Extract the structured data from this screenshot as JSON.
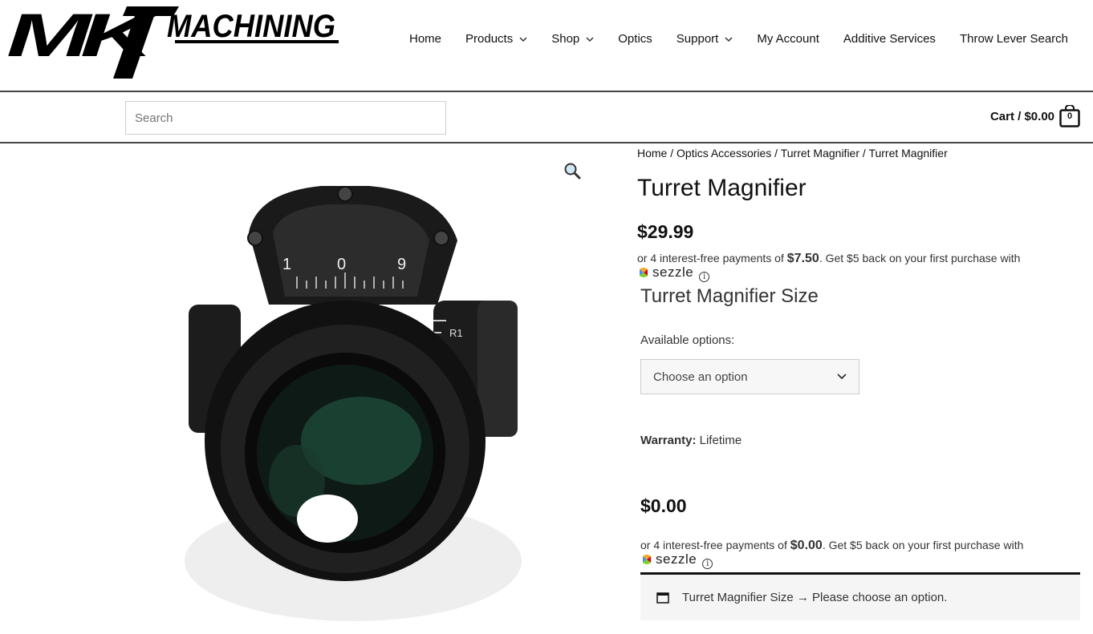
{
  "logo": {
    "text": "MKT MACHINING"
  },
  "nav": {
    "items": [
      {
        "label": "Home",
        "dropdown": false
      },
      {
        "label": "Products",
        "dropdown": true
      },
      {
        "label": "Shop",
        "dropdown": true
      },
      {
        "label": "Optics",
        "dropdown": false
      },
      {
        "label": "Support",
        "dropdown": true
      },
      {
        "label": "My Account",
        "dropdown": false
      },
      {
        "label": "Additive Services",
        "dropdown": false
      },
      {
        "label": "Throw Lever Search",
        "dropdown": false
      }
    ]
  },
  "search": {
    "placeholder": "Search"
  },
  "cart": {
    "label": "Cart / $0.00",
    "count": "0"
  },
  "product": {
    "breadcrumb": {
      "home": "Home",
      "category": "Optics Accessories",
      "parent": "Turret Magnifier",
      "current": "Turret Magnifier",
      "sep": " / "
    },
    "title": "Turret Magnifier",
    "price": "$29.99",
    "sezzle1": {
      "prefix": "or 4 interest-free payments of ",
      "amount": "$7.50",
      "suffix": ". Get $5 back on your first purchase with",
      "brand": "sezzle",
      "info": "i"
    },
    "variation_title": "Turret Magnifier Size",
    "available_label": "Available options:",
    "select_value": "Choose an option",
    "warranty_label": "Warranty:",
    "warranty_value": " Lifetime",
    "price2": "$0.00",
    "sezzle2": {
      "prefix": "or 4 interest-free payments of ",
      "amount": "$0.00",
      "suffix": ". Get $5 back on your first purchase with",
      "brand": "sezzle",
      "info": "i"
    },
    "notice": "Turret Magnifier Size → Please choose an option."
  },
  "icons": {
    "zoom": "magnifier-icon",
    "chevron": "chevron-down-icon",
    "cart": "shopping-bag-icon",
    "notice": "window-icon"
  }
}
